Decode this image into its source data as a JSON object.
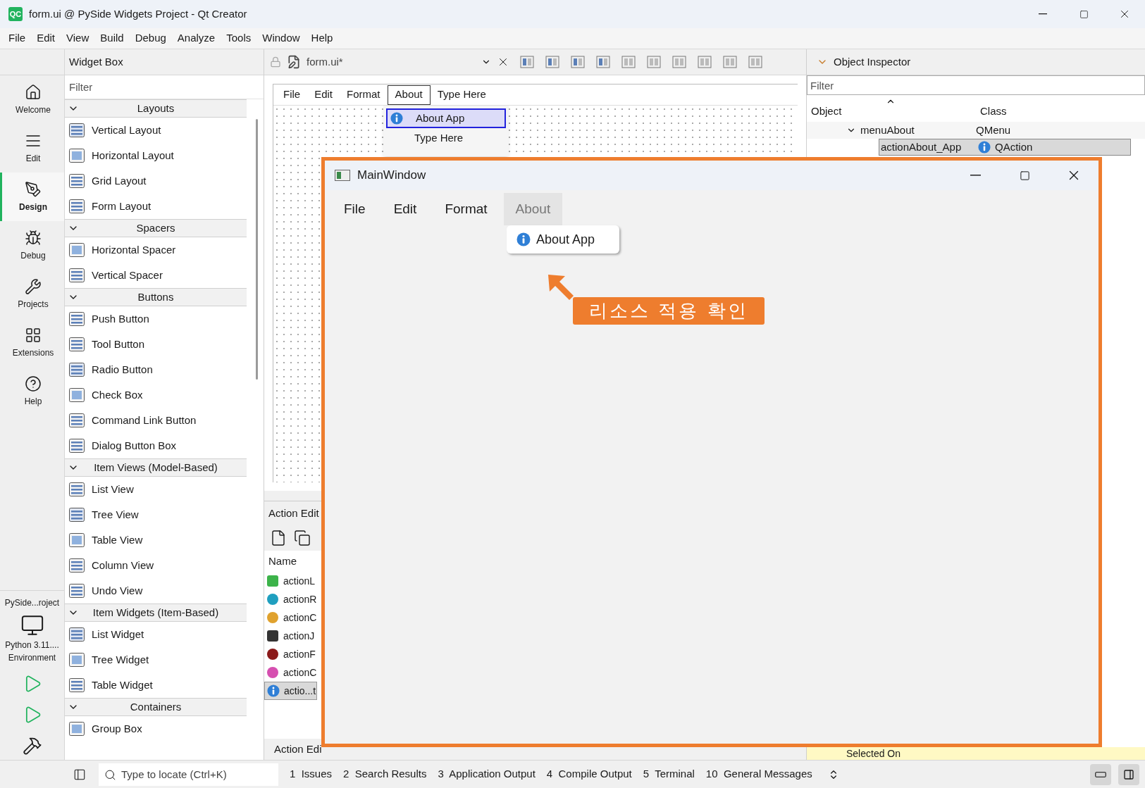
{
  "window": {
    "badge": "QC",
    "title": "form.ui @ PySide Widgets Project - Qt Creator"
  },
  "menu_bar": [
    "File",
    "Edit",
    "View",
    "Build",
    "Debug",
    "Analyze",
    "Tools",
    "Window",
    "Help"
  ],
  "mode_bar": {
    "modes": [
      {
        "label": "Welcome",
        "selected": false
      },
      {
        "label": "Edit",
        "selected": false
      },
      {
        "label": "Design",
        "selected": true
      },
      {
        "label": "Debug",
        "selected": false
      },
      {
        "label": "Projects",
        "selected": false
      },
      {
        "label": "Extensions",
        "selected": false
      },
      {
        "label": "Help",
        "selected": false
      }
    ],
    "project": "PySide...roject",
    "kit": "Python 3.11....",
    "kit_sub": "Environment"
  },
  "widget_box": {
    "title": "Widget Box",
    "filter_placeholder": "Filter",
    "groups": [
      {
        "title": "Layouts",
        "expanded": true,
        "items": [
          "Vertical Layout",
          "Horizontal Layout",
          "Grid Layout",
          "Form Layout"
        ]
      },
      {
        "title": "Spacers",
        "expanded": true,
        "items": [
          "Horizontal Spacer",
          "Vertical Spacer"
        ]
      },
      {
        "title": "Buttons",
        "expanded": true,
        "items": [
          "Push Button",
          "Tool Button",
          "Radio Button",
          "Check Box",
          "Command Link Button",
          "Dialog Button Box"
        ]
      },
      {
        "title": "Item Views (Model-Based)",
        "expanded": true,
        "items": [
          "List View",
          "Tree View",
          "Table View",
          "Column View",
          "Undo View"
        ]
      },
      {
        "title": "Item Widgets (Item-Based)",
        "expanded": true,
        "items": [
          "List Widget",
          "Tree Widget",
          "Table Widget"
        ]
      },
      {
        "title": "Containers",
        "expanded": true,
        "items": [
          "Group Box"
        ]
      }
    ]
  },
  "designer": {
    "file": "form.ui*",
    "menus": [
      {
        "label": "File",
        "selected": false
      },
      {
        "label": "Edit",
        "selected": false
      },
      {
        "label": "Format",
        "selected": false
      },
      {
        "label": "About",
        "selected": true
      },
      {
        "label": "Type Here",
        "selected": false
      }
    ],
    "dropdown": [
      {
        "label": "About App",
        "selected": true
      },
      {
        "label": "Type Here",
        "selected": false
      }
    ]
  },
  "action_editor": {
    "title": "Action Edit",
    "column": "Name",
    "actions": [
      {
        "label": "actionL",
        "selected": false
      },
      {
        "label": "actionR",
        "selected": false
      },
      {
        "label": "actionC",
        "selected": false
      },
      {
        "label": "actionJ",
        "selected": false
      },
      {
        "label": "actionF",
        "selected": false
      },
      {
        "label": "actionC",
        "selected": false
      },
      {
        "label": "actio...t",
        "selected": true
      }
    ],
    "bottom_tab": "Action Edi"
  },
  "object_inspector": {
    "title": "Object Inspector",
    "filter_placeholder": "Filter",
    "columns": [
      "Object",
      "Class"
    ],
    "rows": [
      {
        "object": "menuAbout",
        "class": "QMenu",
        "expanded": true,
        "selected": false,
        "children": [
          {
            "object": "actionAbout_App",
            "class": "QAction",
            "selected": true
          }
        ]
      }
    ]
  },
  "property_editor": {
    "last_row": "Selected On"
  },
  "status_bar": {
    "locator_placeholder": "Type to locate (Ctrl+K)",
    "panes": [
      "1  Issues",
      "2  Search Results",
      "3  Application Output",
      "4  Compile Output",
      "5  Terminal",
      "10  General Messages"
    ]
  },
  "preview": {
    "title": "MainWindow",
    "menus": [
      {
        "label": "File",
        "selected": false
      },
      {
        "label": "Edit",
        "selected": false
      },
      {
        "label": "Format",
        "selected": false
      },
      {
        "label": "About",
        "selected": true
      }
    ],
    "dropdown": [
      "About App"
    ]
  },
  "callout": {
    "text": "리소스 적용 확인"
  }
}
